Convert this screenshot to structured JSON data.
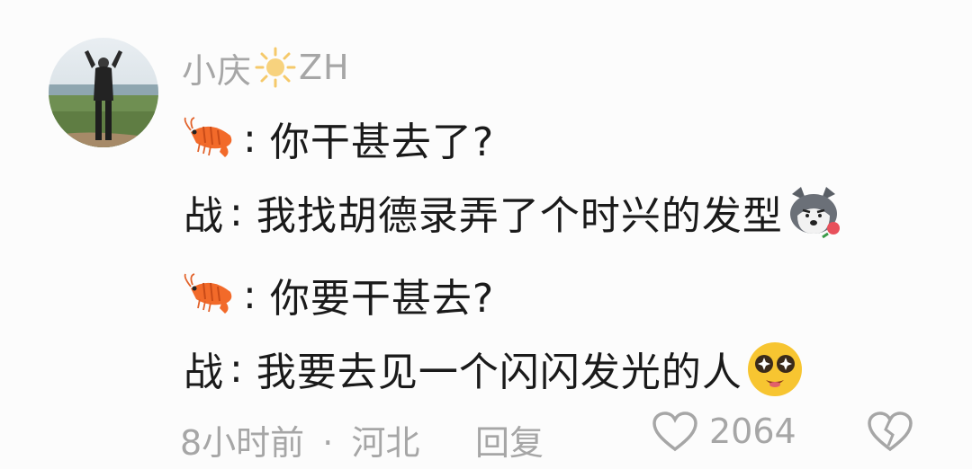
{
  "comment": {
    "username_part1": "小庆",
    "username_part2": "ZH",
    "lines": [
      {
        "speaker_emoji": "shrimp-icon",
        "text": "你干甚去了?"
      },
      {
        "speaker": "战",
        "text": "我找胡德录弄了个时兴的发型",
        "emoji": "husky-rose-icon"
      },
      {
        "speaker_emoji": "shrimp-icon",
        "text": "你要干甚去?"
      },
      {
        "speaker": "战",
        "text": "我要去见一个闪闪发光的人",
        "emoji": "sparkle-eyes-face-icon"
      }
    ],
    "colon": ":",
    "meta": {
      "time": "8小时前",
      "separator": "·",
      "location": "河北"
    },
    "reply_label": "回复",
    "like_count": "2064"
  }
}
